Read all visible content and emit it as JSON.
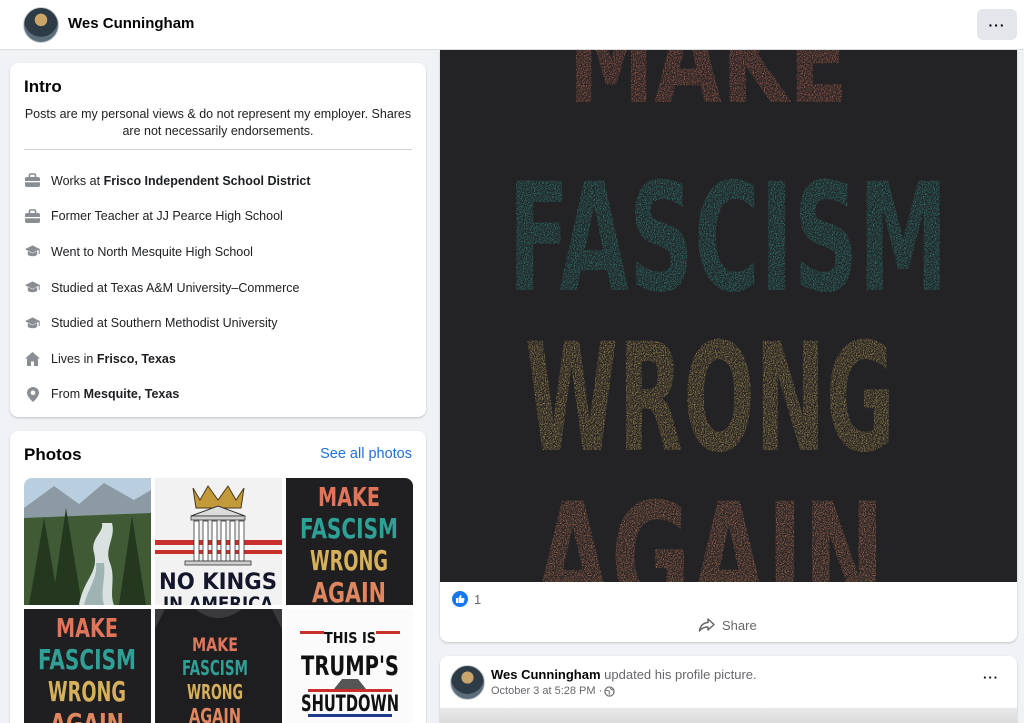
{
  "header": {
    "profile_name": "Wes Cunningham",
    "more_label": "···"
  },
  "intro": {
    "title": "Intro",
    "bio": "Posts are my personal views & do not represent my employer. Shares are not necessarily endorsements.",
    "items": [
      {
        "icon": "briefcase-icon",
        "prefix": "Works at ",
        "bold": "Frisco Independent School District"
      },
      {
        "icon": "briefcase-icon",
        "prefix": "Former Teacher at JJ Pearce High School",
        "bold": ""
      },
      {
        "icon": "graduation-cap-icon",
        "prefix": "Went to North Mesquite High School",
        "bold": ""
      },
      {
        "icon": "graduation-cap-icon",
        "prefix": "Studied at Texas A&M University–Commerce",
        "bold": ""
      },
      {
        "icon": "graduation-cap-icon",
        "prefix": "Studied at Southern Methodist University",
        "bold": ""
      },
      {
        "icon": "home-icon",
        "prefix": "Lives in ",
        "bold": "Frisco, Texas"
      },
      {
        "icon": "location-pin-icon",
        "prefix": "From ",
        "bold": "Mesquite, Texas"
      }
    ]
  },
  "photos": {
    "title": "Photos",
    "see_all": "See all photos",
    "tiles": [
      {
        "kind": "landscape"
      },
      {
        "kind": "no-kings",
        "text": [
          "NO KINGS",
          "IN AMERICA"
        ]
      },
      {
        "kind": "make-fascism",
        "text": [
          "MAKE",
          "FASCISM",
          "WRONG",
          "AGAIN"
        ]
      },
      {
        "kind": "make-fascism",
        "text": [
          "MAKE",
          "FASCISM",
          "WRONG",
          "AGAIN"
        ]
      },
      {
        "kind": "make-fascism-shirt",
        "text": [
          "MAKE",
          "FASCISM",
          "WRONG",
          "AGAIN"
        ]
      },
      {
        "kind": "shutdown",
        "text": [
          "THIS IS",
          "TRUMP'S",
          "SHUTDOWN"
        ]
      }
    ]
  },
  "post": {
    "image_text": [
      "MAKE",
      "FASCISM",
      "WRONG",
      "AGAIN"
    ],
    "like_count": "1",
    "share_label": "Share"
  },
  "post2": {
    "author": "Wes Cunningham",
    "action": " updated his profile picture.",
    "date": "October 3 at 5:28 PM · ",
    "more_label": "···"
  },
  "colors": {
    "accent": "#216fdb",
    "make": "#e0755a",
    "fascism": "#2fa095",
    "wrong": "#d7b05c",
    "again": "#e0875f",
    "poster_bg": "#222224"
  }
}
